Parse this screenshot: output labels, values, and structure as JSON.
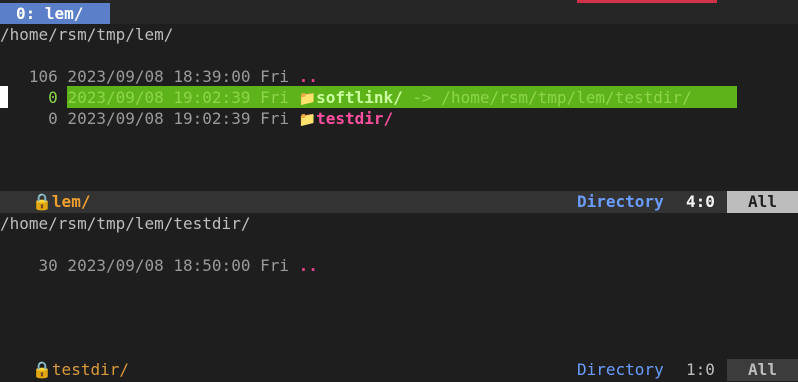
{
  "tab": {
    "label": "0: lem/"
  },
  "top_pane": {
    "path": "/home/rsm/tmp/lem/",
    "entries": [
      {
        "meta": "   106 2023/09/08 18:39:00 Fri ",
        "name": ".."
      },
      {
        "meta": "     0 2023/09/08 19:02:39 Fri ",
        "icon": "📁",
        "name": "softlink/",
        "target": " -> /home/rsm/tmp/lem/testdir/"
      },
      {
        "meta": "     0 2023/09/08 19:02:39 Fri ",
        "icon": "📁",
        "name": "testdir/"
      }
    ],
    "modeline": {
      "lock": "🔒",
      "buffer": "lem/",
      "mode": "Directory",
      "position": "4:0",
      "scroll": "All"
    }
  },
  "bottom_pane": {
    "path": "/home/rsm/tmp/lem/testdir/",
    "entries": [
      {
        "meta": "    30 2023/09/08 18:50:00 Fri ",
        "name": ".."
      }
    ],
    "modeline": {
      "lock": "🔒",
      "buffer": "testdir/",
      "mode": "Directory",
      "position": "1:0",
      "scroll": "All"
    }
  },
  "colors": {
    "background": "#1e1e1e",
    "tab_active": "#5b7fc8",
    "selection": "#5fb31a",
    "directory": "#ff4fa0",
    "mode_name": "#f0a030",
    "mode_label": "#6a9dff"
  }
}
